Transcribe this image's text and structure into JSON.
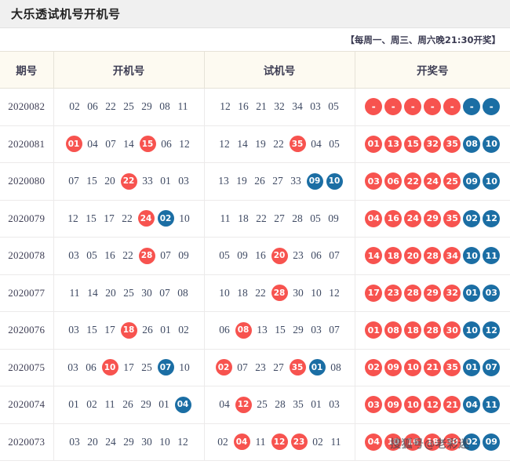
{
  "header": {
    "title": "大乐透试机号开机号",
    "note": "【每周一、周三、周六晚21:30开奖】"
  },
  "colors": {
    "red_ball": "#f7534f",
    "blue_ball": "#1b6ea4",
    "header_bg": "#fdfaf1",
    "titlebar_bg": "#f0f0f0"
  },
  "watermark": "搜狐号@老彩迷",
  "table": {
    "columns": [
      "期号",
      "开机号",
      "试机号",
      "开奖号"
    ],
    "rows": [
      {
        "period": "2020082",
        "open": [
          {
            "v": "02",
            "s": "plain"
          },
          {
            "v": "06",
            "s": "plain"
          },
          {
            "v": "22",
            "s": "plain"
          },
          {
            "v": "25",
            "s": "plain"
          },
          {
            "v": "29",
            "s": "plain"
          },
          {
            "v": "08",
            "s": "plain"
          },
          {
            "v": "11",
            "s": "plain"
          }
        ],
        "test": [
          {
            "v": "12",
            "s": "plain"
          },
          {
            "v": "16",
            "s": "plain"
          },
          {
            "v": "21",
            "s": "plain"
          },
          {
            "v": "32",
            "s": "plain"
          },
          {
            "v": "34",
            "s": "plain"
          },
          {
            "v": "03",
            "s": "plain"
          },
          {
            "v": "05",
            "s": "plain"
          }
        ],
        "draw": [
          {
            "v": "-",
            "s": "red"
          },
          {
            "v": "-",
            "s": "red"
          },
          {
            "v": "-",
            "s": "red"
          },
          {
            "v": "-",
            "s": "red"
          },
          {
            "v": "-",
            "s": "red"
          },
          {
            "v": "-",
            "s": "blue"
          },
          {
            "v": "-",
            "s": "blue"
          }
        ]
      },
      {
        "period": "2020081",
        "open": [
          {
            "v": "01",
            "s": "red"
          },
          {
            "v": "04",
            "s": "plain"
          },
          {
            "v": "07",
            "s": "plain"
          },
          {
            "v": "14",
            "s": "plain"
          },
          {
            "v": "15",
            "s": "red"
          },
          {
            "v": "06",
            "s": "plain"
          },
          {
            "v": "12",
            "s": "plain"
          }
        ],
        "test": [
          {
            "v": "12",
            "s": "plain"
          },
          {
            "v": "14",
            "s": "plain"
          },
          {
            "v": "19",
            "s": "plain"
          },
          {
            "v": "22",
            "s": "plain"
          },
          {
            "v": "35",
            "s": "red"
          },
          {
            "v": "04",
            "s": "plain"
          },
          {
            "v": "05",
            "s": "plain"
          }
        ],
        "draw": [
          {
            "v": "01",
            "s": "red"
          },
          {
            "v": "13",
            "s": "red"
          },
          {
            "v": "15",
            "s": "red"
          },
          {
            "v": "32",
            "s": "red"
          },
          {
            "v": "35",
            "s": "red"
          },
          {
            "v": "08",
            "s": "blue"
          },
          {
            "v": "10",
            "s": "blue"
          }
        ]
      },
      {
        "period": "2020080",
        "open": [
          {
            "v": "07",
            "s": "plain"
          },
          {
            "v": "15",
            "s": "plain"
          },
          {
            "v": "20",
            "s": "plain"
          },
          {
            "v": "22",
            "s": "red"
          },
          {
            "v": "33",
            "s": "plain"
          },
          {
            "v": "01",
            "s": "plain"
          },
          {
            "v": "03",
            "s": "plain"
          }
        ],
        "test": [
          {
            "v": "13",
            "s": "plain"
          },
          {
            "v": "19",
            "s": "plain"
          },
          {
            "v": "26",
            "s": "plain"
          },
          {
            "v": "27",
            "s": "plain"
          },
          {
            "v": "33",
            "s": "plain"
          },
          {
            "v": "09",
            "s": "blue"
          },
          {
            "v": "10",
            "s": "blue"
          }
        ],
        "draw": [
          {
            "v": "03",
            "s": "red"
          },
          {
            "v": "06",
            "s": "red"
          },
          {
            "v": "22",
            "s": "red"
          },
          {
            "v": "24",
            "s": "red"
          },
          {
            "v": "25",
            "s": "red"
          },
          {
            "v": "09",
            "s": "blue"
          },
          {
            "v": "10",
            "s": "blue"
          }
        ]
      },
      {
        "period": "2020079",
        "open": [
          {
            "v": "12",
            "s": "plain"
          },
          {
            "v": "15",
            "s": "plain"
          },
          {
            "v": "17",
            "s": "plain"
          },
          {
            "v": "22",
            "s": "plain"
          },
          {
            "v": "24",
            "s": "red"
          },
          {
            "v": "02",
            "s": "blue"
          },
          {
            "v": "10",
            "s": "plain"
          }
        ],
        "test": [
          {
            "v": "11",
            "s": "plain"
          },
          {
            "v": "18",
            "s": "plain"
          },
          {
            "v": "22",
            "s": "plain"
          },
          {
            "v": "27",
            "s": "plain"
          },
          {
            "v": "28",
            "s": "plain"
          },
          {
            "v": "05",
            "s": "plain"
          },
          {
            "v": "09",
            "s": "plain"
          }
        ],
        "draw": [
          {
            "v": "04",
            "s": "red"
          },
          {
            "v": "16",
            "s": "red"
          },
          {
            "v": "24",
            "s": "red"
          },
          {
            "v": "29",
            "s": "red"
          },
          {
            "v": "35",
            "s": "red"
          },
          {
            "v": "02",
            "s": "blue"
          },
          {
            "v": "12",
            "s": "blue"
          }
        ]
      },
      {
        "period": "2020078",
        "open": [
          {
            "v": "03",
            "s": "plain"
          },
          {
            "v": "05",
            "s": "plain"
          },
          {
            "v": "16",
            "s": "plain"
          },
          {
            "v": "22",
            "s": "plain"
          },
          {
            "v": "28",
            "s": "red"
          },
          {
            "v": "07",
            "s": "plain"
          },
          {
            "v": "09",
            "s": "plain"
          }
        ],
        "test": [
          {
            "v": "05",
            "s": "plain"
          },
          {
            "v": "09",
            "s": "plain"
          },
          {
            "v": "16",
            "s": "plain"
          },
          {
            "v": "20",
            "s": "red"
          },
          {
            "v": "23",
            "s": "plain"
          },
          {
            "v": "06",
            "s": "plain"
          },
          {
            "v": "07",
            "s": "plain"
          }
        ],
        "draw": [
          {
            "v": "14",
            "s": "red"
          },
          {
            "v": "18",
            "s": "red"
          },
          {
            "v": "20",
            "s": "red"
          },
          {
            "v": "28",
            "s": "red"
          },
          {
            "v": "34",
            "s": "red"
          },
          {
            "v": "10",
            "s": "blue"
          },
          {
            "v": "11",
            "s": "blue"
          }
        ]
      },
      {
        "period": "2020077",
        "open": [
          {
            "v": "11",
            "s": "plain"
          },
          {
            "v": "14",
            "s": "plain"
          },
          {
            "v": "20",
            "s": "plain"
          },
          {
            "v": "25",
            "s": "plain"
          },
          {
            "v": "30",
            "s": "plain"
          },
          {
            "v": "07",
            "s": "plain"
          },
          {
            "v": "08",
            "s": "plain"
          }
        ],
        "test": [
          {
            "v": "10",
            "s": "plain"
          },
          {
            "v": "18",
            "s": "plain"
          },
          {
            "v": "22",
            "s": "plain"
          },
          {
            "v": "28",
            "s": "red"
          },
          {
            "v": "30",
            "s": "plain"
          },
          {
            "v": "10",
            "s": "plain"
          },
          {
            "v": "12",
            "s": "plain"
          }
        ],
        "draw": [
          {
            "v": "17",
            "s": "red"
          },
          {
            "v": "23",
            "s": "red"
          },
          {
            "v": "28",
            "s": "red"
          },
          {
            "v": "29",
            "s": "red"
          },
          {
            "v": "32",
            "s": "red"
          },
          {
            "v": "01",
            "s": "blue"
          },
          {
            "v": "03",
            "s": "blue"
          }
        ]
      },
      {
        "period": "2020076",
        "open": [
          {
            "v": "03",
            "s": "plain"
          },
          {
            "v": "15",
            "s": "plain"
          },
          {
            "v": "17",
            "s": "plain"
          },
          {
            "v": "18",
            "s": "red"
          },
          {
            "v": "26",
            "s": "plain"
          },
          {
            "v": "01",
            "s": "plain"
          },
          {
            "v": "02",
            "s": "plain"
          }
        ],
        "test": [
          {
            "v": "06",
            "s": "plain"
          },
          {
            "v": "08",
            "s": "red"
          },
          {
            "v": "13",
            "s": "plain"
          },
          {
            "v": "15",
            "s": "plain"
          },
          {
            "v": "29",
            "s": "plain"
          },
          {
            "v": "03",
            "s": "plain"
          },
          {
            "v": "07",
            "s": "plain"
          }
        ],
        "draw": [
          {
            "v": "01",
            "s": "red"
          },
          {
            "v": "08",
            "s": "red"
          },
          {
            "v": "18",
            "s": "red"
          },
          {
            "v": "28",
            "s": "red"
          },
          {
            "v": "30",
            "s": "red"
          },
          {
            "v": "10",
            "s": "blue"
          },
          {
            "v": "12",
            "s": "blue"
          }
        ]
      },
      {
        "period": "2020075",
        "open": [
          {
            "v": "03",
            "s": "plain"
          },
          {
            "v": "06",
            "s": "plain"
          },
          {
            "v": "10",
            "s": "red"
          },
          {
            "v": "17",
            "s": "plain"
          },
          {
            "v": "25",
            "s": "plain"
          },
          {
            "v": "07",
            "s": "blue"
          },
          {
            "v": "10",
            "s": "plain"
          }
        ],
        "test": [
          {
            "v": "02",
            "s": "red"
          },
          {
            "v": "07",
            "s": "plain"
          },
          {
            "v": "23",
            "s": "plain"
          },
          {
            "v": "27",
            "s": "plain"
          },
          {
            "v": "35",
            "s": "red"
          },
          {
            "v": "01",
            "s": "blue"
          },
          {
            "v": "08",
            "s": "plain"
          }
        ],
        "draw": [
          {
            "v": "02",
            "s": "red"
          },
          {
            "v": "09",
            "s": "red"
          },
          {
            "v": "10",
            "s": "red"
          },
          {
            "v": "21",
            "s": "red"
          },
          {
            "v": "35",
            "s": "red"
          },
          {
            "v": "01",
            "s": "blue"
          },
          {
            "v": "07",
            "s": "blue"
          }
        ]
      },
      {
        "period": "2020074",
        "open": [
          {
            "v": "01",
            "s": "plain"
          },
          {
            "v": "02",
            "s": "plain"
          },
          {
            "v": "11",
            "s": "plain"
          },
          {
            "v": "26",
            "s": "plain"
          },
          {
            "v": "29",
            "s": "plain"
          },
          {
            "v": "01",
            "s": "plain"
          },
          {
            "v": "04",
            "s": "blue"
          }
        ],
        "test": [
          {
            "v": "04",
            "s": "plain"
          },
          {
            "v": "12",
            "s": "red"
          },
          {
            "v": "25",
            "s": "plain"
          },
          {
            "v": "28",
            "s": "plain"
          },
          {
            "v": "35",
            "s": "plain"
          },
          {
            "v": "01",
            "s": "plain"
          },
          {
            "v": "03",
            "s": "plain"
          }
        ],
        "draw": [
          {
            "v": "03",
            "s": "red"
          },
          {
            "v": "09",
            "s": "red"
          },
          {
            "v": "10",
            "s": "red"
          },
          {
            "v": "12",
            "s": "red"
          },
          {
            "v": "21",
            "s": "red"
          },
          {
            "v": "04",
            "s": "blue"
          },
          {
            "v": "11",
            "s": "blue"
          }
        ]
      },
      {
        "period": "2020073",
        "open": [
          {
            "v": "03",
            "s": "plain"
          },
          {
            "v": "20",
            "s": "plain"
          },
          {
            "v": "24",
            "s": "plain"
          },
          {
            "v": "29",
            "s": "plain"
          },
          {
            "v": "30",
            "s": "plain"
          },
          {
            "v": "10",
            "s": "plain"
          },
          {
            "v": "12",
            "s": "plain"
          }
        ],
        "test": [
          {
            "v": "02",
            "s": "plain"
          },
          {
            "v": "04",
            "s": "red"
          },
          {
            "v": "11",
            "s": "plain"
          },
          {
            "v": "12",
            "s": "red"
          },
          {
            "v": "23",
            "s": "red"
          },
          {
            "v": "02",
            "s": "plain"
          },
          {
            "v": "11",
            "s": "plain"
          }
        ],
        "draw": [
          {
            "v": "04",
            "s": "red"
          },
          {
            "v": "10",
            "s": "red"
          },
          {
            "v": "16",
            "s": "red"
          },
          {
            "v": "18",
            "s": "red"
          },
          {
            "v": "30",
            "s": "red"
          },
          {
            "v": "02",
            "s": "blue"
          },
          {
            "v": "09",
            "s": "blue"
          }
        ]
      }
    ]
  }
}
